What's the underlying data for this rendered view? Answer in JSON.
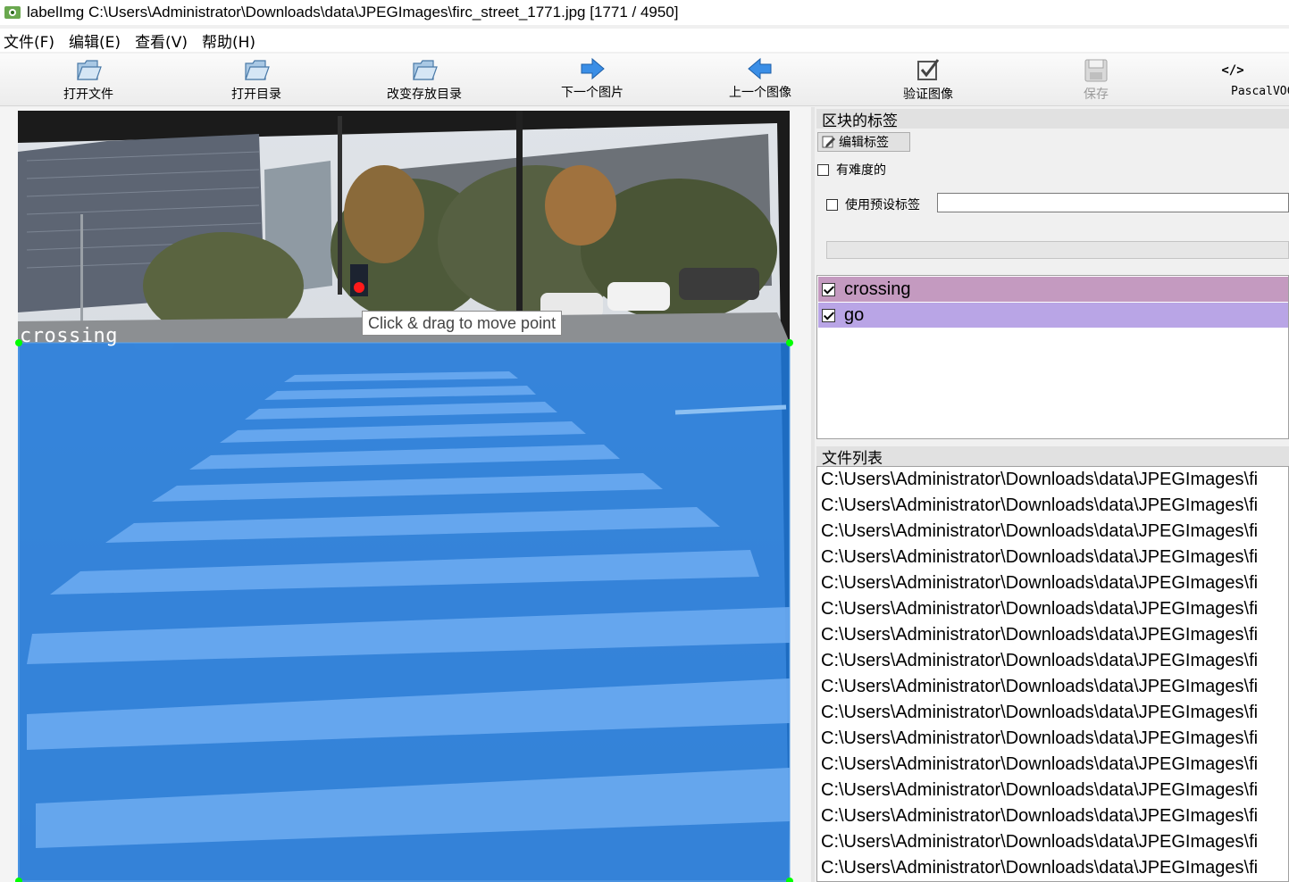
{
  "window": {
    "title": "labelImg C:\\Users\\Administrator\\Downloads\\data\\JPEGImages\\firc_street_1771.jpg [1771 / 4950]"
  },
  "menu": {
    "items": [
      "文件(F)",
      "编辑(E)",
      "查看(V)",
      "帮助(H)"
    ]
  },
  "toolbar": {
    "open_file": "打开文件",
    "open_dir": "打开目录",
    "change_save_dir": "改变存放目录",
    "next_image": "下一个图片",
    "prev_image": "上一个图像",
    "verify_image": "验证图像",
    "save": "保存",
    "format": "PascalVOC",
    "save_enabled": false
  },
  "canvas": {
    "box_label": "crossing",
    "tooltip": "Click & drag to move point",
    "box_fill_color": "#1f78d8",
    "vertex_color": "#00ff00"
  },
  "dock": {
    "labels_panel_title": "区块的标签",
    "edit_label_button": "编辑标签",
    "difficult_label": "有难度的",
    "difficult_checked": false,
    "use_default_label": "使用预设标签",
    "use_default_checked": false,
    "default_label_value": "",
    "labels": [
      {
        "name": "crossing",
        "checked": true,
        "color": "#c49ac0"
      },
      {
        "name": "go",
        "checked": true,
        "color": "#b9a5e6"
      }
    ],
    "file_list_title": "文件列表",
    "files": [
      "C:\\Users\\Administrator\\Downloads\\data\\JPEGImages\\fi",
      "C:\\Users\\Administrator\\Downloads\\data\\JPEGImages\\fi",
      "C:\\Users\\Administrator\\Downloads\\data\\JPEGImages\\fi",
      "C:\\Users\\Administrator\\Downloads\\data\\JPEGImages\\fi",
      "C:\\Users\\Administrator\\Downloads\\data\\JPEGImages\\fi",
      "C:\\Users\\Administrator\\Downloads\\data\\JPEGImages\\fi",
      "C:\\Users\\Administrator\\Downloads\\data\\JPEGImages\\fi",
      "C:\\Users\\Administrator\\Downloads\\data\\JPEGImages\\fi",
      "C:\\Users\\Administrator\\Downloads\\data\\JPEGImages\\fi",
      "C:\\Users\\Administrator\\Downloads\\data\\JPEGImages\\fi",
      "C:\\Users\\Administrator\\Downloads\\data\\JPEGImages\\fi",
      "C:\\Users\\Administrator\\Downloads\\data\\JPEGImages\\fi",
      "C:\\Users\\Administrator\\Downloads\\data\\JPEGImages\\fi",
      "C:\\Users\\Administrator\\Downloads\\data\\JPEGImages\\fi",
      "C:\\Users\\Administrator\\Downloads\\data\\JPEGImages\\fi",
      "C:\\Users\\Administrator\\Downloads\\data\\JPEGImages\\fi"
    ]
  }
}
